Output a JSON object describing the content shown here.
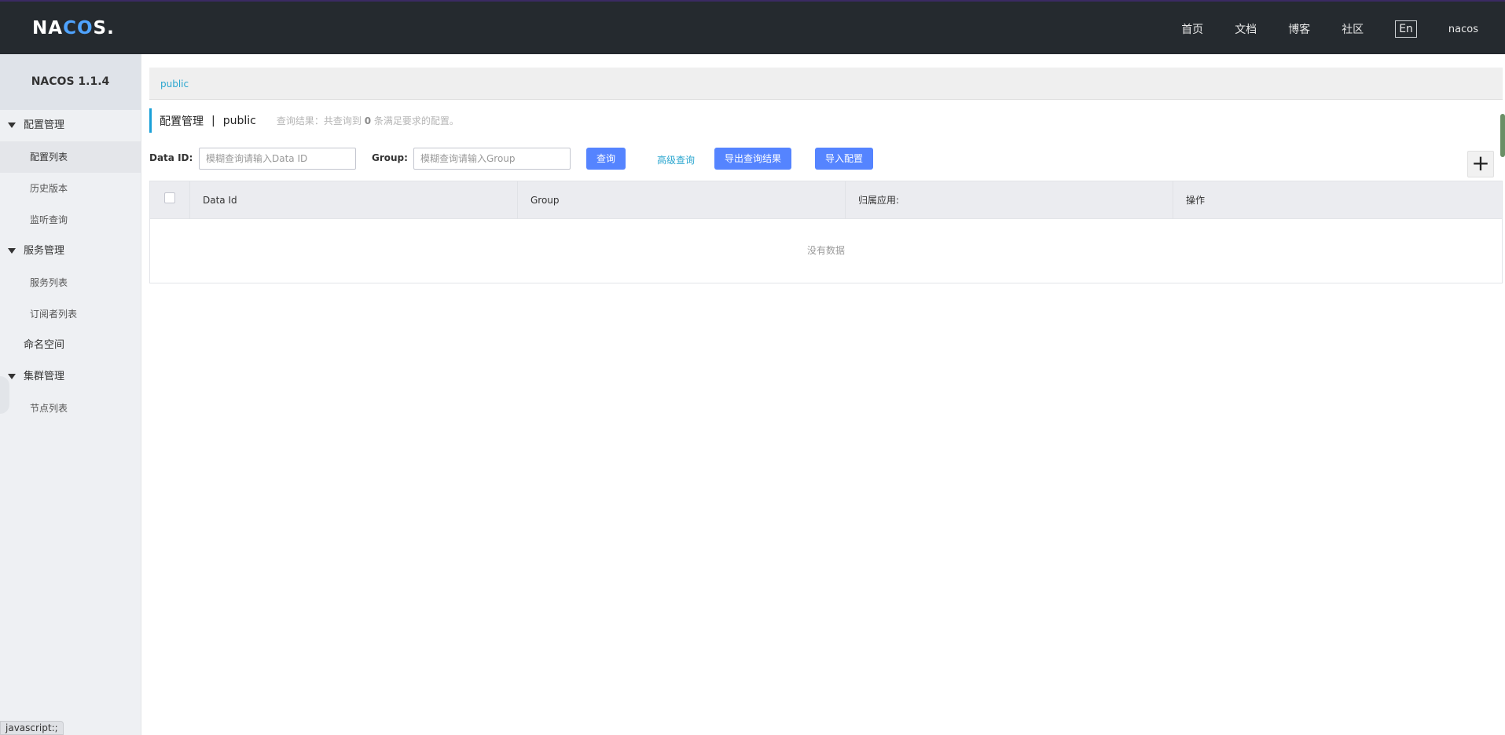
{
  "header": {
    "logo": "NACOS.",
    "nav": [
      "首页",
      "文档",
      "博客",
      "社区"
    ],
    "lang": "En",
    "user": "nacos"
  },
  "sidebar": {
    "title": "NACOS 1.1.4",
    "groups": [
      {
        "label": "配置管理",
        "items": [
          "配置列表",
          "历史版本",
          "监听查询"
        ]
      },
      {
        "label": "服务管理",
        "items": [
          "服务列表",
          "订阅者列表"
        ]
      },
      {
        "label": "命名空间"
      },
      {
        "label": "集群管理",
        "items": [
          "节点列表"
        ]
      }
    ],
    "active_item": "配置列表"
  },
  "main": {
    "namespace_link": "public",
    "title": "配置管理",
    "separator": "|",
    "namespace": "public",
    "result_prefix": "查询结果：共查询到",
    "result_count": "0",
    "result_suffix": "条满足要求的配置。",
    "search": {
      "dataid_label": "Data ID:",
      "dataid_placeholder": "模糊查询请输入Data ID",
      "group_label": "Group:",
      "group_placeholder": "模糊查询请输入Group",
      "query_btn": "查询",
      "advanced_link": "高级查询",
      "export_btn": "导出查询结果",
      "import_btn": "导入配置",
      "add_btn": "+"
    },
    "table": {
      "columns": [
        "Data Id",
        "Group",
        "归属应用:",
        "操作"
      ],
      "empty_text": "没有数据"
    }
  },
  "statusbar": "javascript:;"
}
